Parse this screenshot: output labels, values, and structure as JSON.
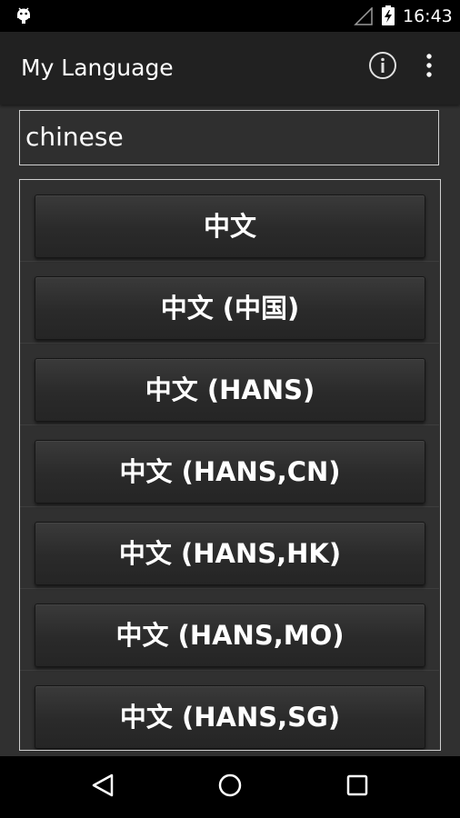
{
  "status_bar": {
    "time": "16:43",
    "left_icon": "android-debug-icon",
    "signal_icon": "signal-icon",
    "battery_icon": "battery-charging-icon"
  },
  "app_bar": {
    "title": "My Language",
    "info_icon": "info-icon",
    "overflow_icon": "more-vert-icon"
  },
  "search": {
    "value": "chinese"
  },
  "languages": [
    "中文",
    "中文 (中国)",
    "中文 (HANS)",
    "中文 (HANS,CN)",
    "中文 (HANS,HK)",
    "中文 (HANS,MO)",
    "中文 (HANS,SG)"
  ],
  "nav_bar": {
    "back_icon": "back-icon",
    "home_icon": "home-icon",
    "recents_icon": "recents-icon"
  },
  "colors": {
    "background": "#303030",
    "app_bar": "#212121",
    "border": "#cfcfcf"
  }
}
